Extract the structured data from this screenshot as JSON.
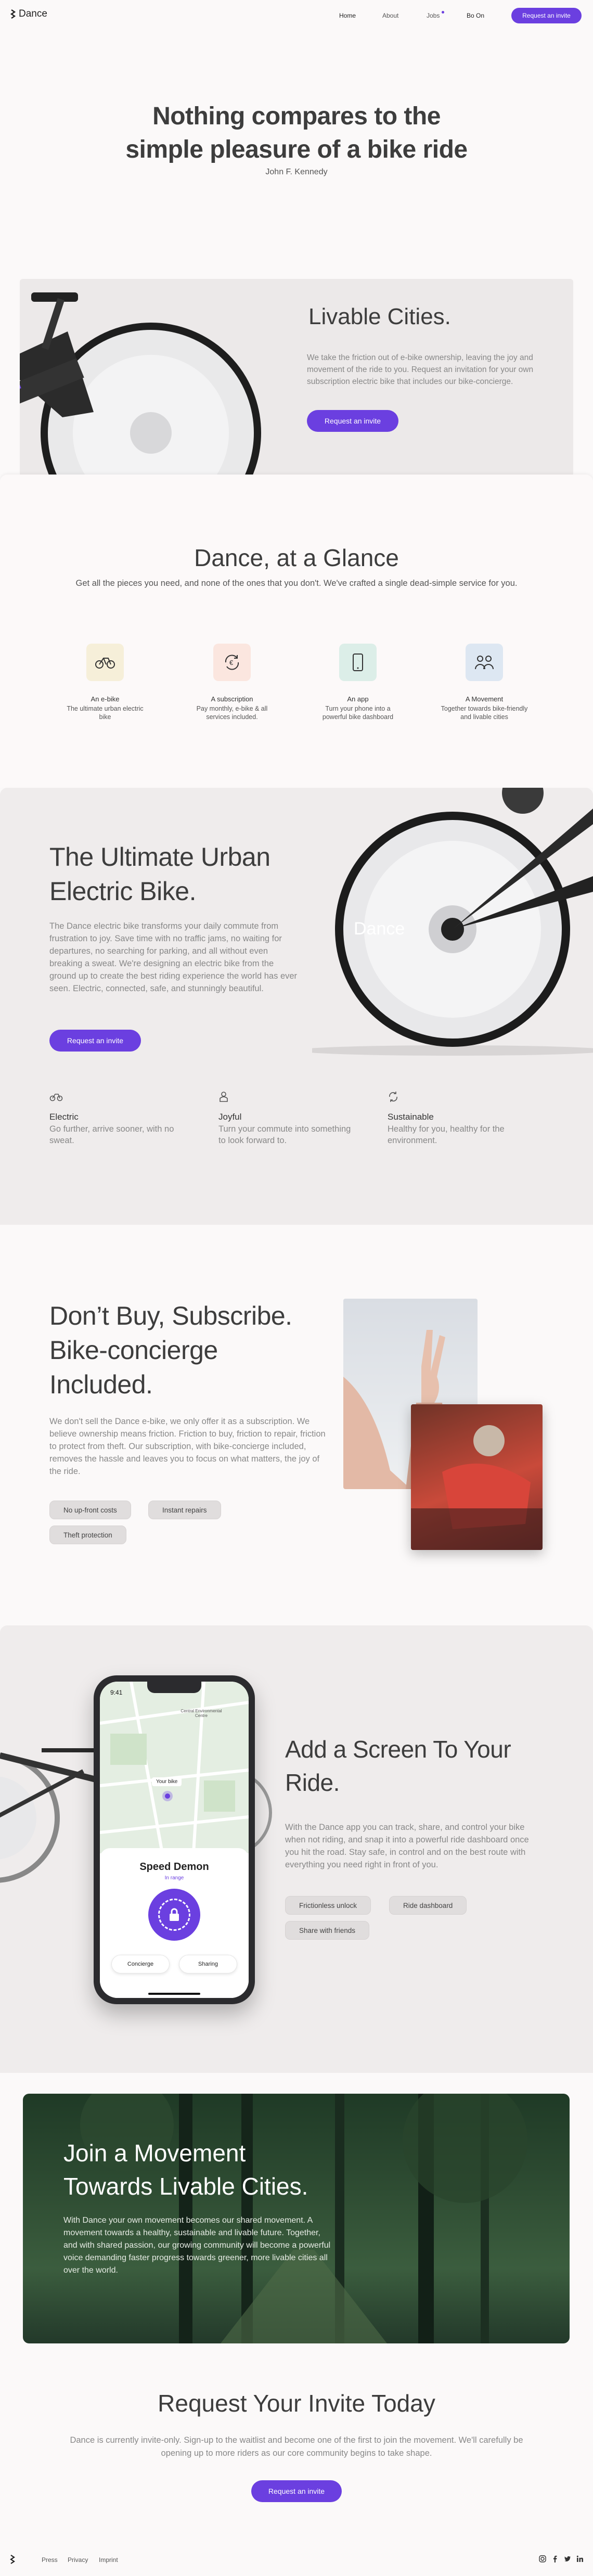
{
  "nav": {
    "logo": "Dance",
    "links": [
      "Home",
      "About",
      "Jobs",
      "Bo On"
    ],
    "cta": "Request an invite"
  },
  "hero": {
    "title_l1": "Nothing compares to the",
    "title_l2": "simple pleasure of a bike ride",
    "author": "John F. Kennedy"
  },
  "livable": {
    "heading": "Livable Cities.",
    "text": "We take the friction out of e-bike ownership, leaving the joy and movement of the ride to you. Request an invitation for your own subscription electric bike that includes our bike-concierge.",
    "cta": "Request an invite"
  },
  "glance": {
    "title": "Dance, at a Glance",
    "subtitle": "Get all the pieces you need, and none of the ones that you don't. We've crafted a single dead-simple service for you.",
    "items": [
      {
        "title": "An e-bike",
        "text": "The ultimate urban electric bike",
        "icon": "bike-icon",
        "bg": "#f6efd9"
      },
      {
        "title": "A subscription",
        "text": "Pay monthly, e-bike & all services included.",
        "icon": "subscription-icon",
        "bg": "#fbe6df"
      },
      {
        "title": "An app",
        "text": "Turn your phone into a powerful bike dashboard",
        "icon": "phone-icon",
        "bg": "#dceee8"
      },
      {
        "title": "A Movement",
        "text": "Together towards bike-friendly and livable cities",
        "icon": "people-icon",
        "bg": "#dde7f2"
      }
    ]
  },
  "urban": {
    "title_l1": "The Ultimate Urban",
    "title_l2": "Electric Bike.",
    "text": "The Dance electric bike transforms your daily commute from frustration to joy. Save time with no traffic jams, no waiting for departures, no searching for parking, and all without even breaking a sweat. We're designing an electric bike from the ground up to create the best riding experience the world has ever seen. Electric, connected, safe, and stunningly beautiful.",
    "cta": "Request an invite",
    "features": [
      {
        "title": "Electric",
        "text": "Go further, arrive sooner, with no sweat.",
        "icon": "bike-small-icon"
      },
      {
        "title": "Joyful",
        "text": "Turn your commute into something to look forward to.",
        "icon": "person-icon"
      },
      {
        "title": "Sustainable",
        "text": "Healthy for you, healthy for the environment.",
        "icon": "recycle-icon"
      }
    ]
  },
  "subscribe": {
    "title_l1": "Don’t Buy, Subscribe.",
    "title_l2": "Bike-concierge",
    "title_l3": "Included.",
    "text": "We don't sell the Dance e-bike, we only offer it as a subscription. We believe ownership means friction. Friction to buy, friction to repair, friction to protect from theft. Our subscription, with bike-concierge included, removes the hassle and leaves you to focus on what matters, the joy of the ride.",
    "chips": [
      "No up-front costs",
      "Instant repairs",
      "Theft protection"
    ]
  },
  "app": {
    "title_l1": "Add a Screen To Your",
    "title_l2": "Ride.",
    "text": "With the Dance app you can track, share, and control your bike when not riding, and snap it into a powerful ride dashboard once you hit the road. Stay safe, in control and on the best route with everything you need right in front of you.",
    "chips": [
      "Frictionless unlock",
      "Ride dashboard",
      "Share with friends"
    ],
    "phone": {
      "time": "9:41",
      "map_label": "Your bike",
      "map_place": "Central Environmental Centre",
      "bike_name": "Speed Demon",
      "status": "In range",
      "btn_left": "Concierge",
      "btn_right": "Sharing"
    }
  },
  "movement": {
    "title_l1": "Join a Movement",
    "title_l2": "Towards Livable Cities.",
    "text": "With Dance your own movement becomes our shared movement. A movement towards a healthy, sustainable and livable future. Together, and with shared passion, our growing community will become a powerful voice demanding faster progress towards greener, more livable cities all over the world."
  },
  "invite": {
    "title": "Request Your Invite Today",
    "text": "Dance is currently invite-only. Sign-up to the waitlist and become one of the first to join the movement. We'll carefully be opening up to more riders as our core community begins to take shape.",
    "cta": "Request an invite"
  },
  "footer": {
    "links": [
      "Press",
      "Privacy",
      "Imprint"
    ],
    "social": [
      "instagram-icon",
      "facebook-icon",
      "twitter-icon",
      "linkedin-icon"
    ]
  },
  "colors": {
    "accent": "#6b3fe0"
  }
}
